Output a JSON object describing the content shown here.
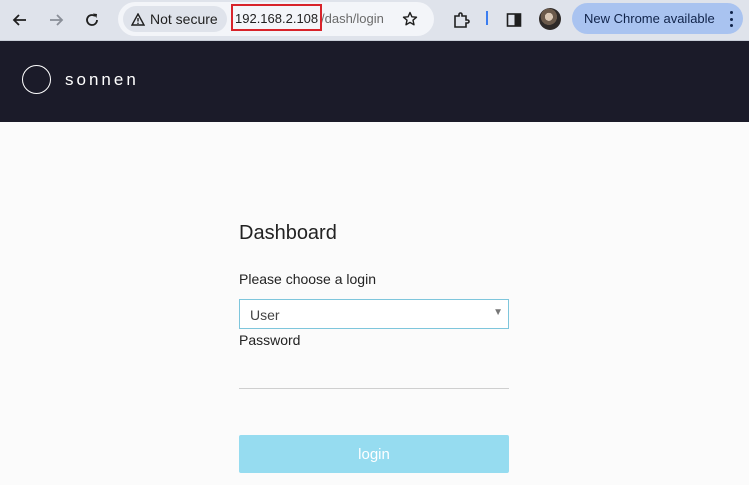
{
  "browser": {
    "security_label": "Not secure",
    "url_host": "192.168.2.108",
    "url_path": "/dash/login",
    "update_label": "New Chrome available",
    "icons": {
      "back": "arrow-left-icon",
      "forward": "arrow-right-icon",
      "reload": "reload-icon",
      "warning": "warning-icon",
      "bookmark": "star-icon",
      "extensions": "puzzle-icon",
      "side_panel": "side-panel-icon",
      "menu": "kebab-menu-icon"
    }
  },
  "header": {
    "brand": "sonnen",
    "background": "#1b1b29"
  },
  "login": {
    "title": "Dashboard",
    "choose_label": "Please choose a login",
    "selected_user": "User",
    "password_label": "Password",
    "password_value": "",
    "button_label": "login",
    "button_color": "#96dcf0"
  }
}
